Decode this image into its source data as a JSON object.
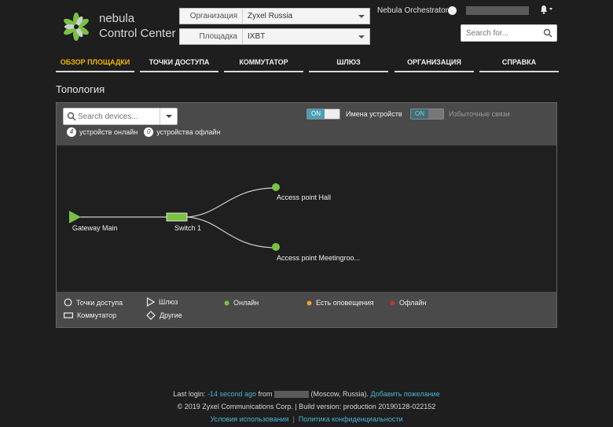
{
  "brand": {
    "line1": "nebula",
    "line2": "Control Center",
    "icon": "nebula-flower-logo"
  },
  "selectors": [
    {
      "label": "Организация",
      "value": "Zyxel Russia"
    },
    {
      "label": "Площадка",
      "value": "IXBT"
    }
  ],
  "header": {
    "orchestrator": "Nebula Orchestrator",
    "search_placeholder": "Search for...",
    "bell_icon": "bell-icon"
  },
  "nav": [
    {
      "label": "ОБЗОР ПЛОЩАДКИ",
      "active": true
    },
    {
      "label": "ТОЧКИ ДОСТУПА"
    },
    {
      "label": "КОММУТАТОР"
    },
    {
      "label": "ШЛЮЗ"
    },
    {
      "label": "ОРГАНИЗАЦИЯ"
    },
    {
      "label": "СПРАВКА"
    }
  ],
  "page_title": "Топология",
  "toolbar": {
    "device_search_placeholder": "Search devices...",
    "online_count": "4",
    "online_label": "устройств онлайн",
    "offline_count": "0",
    "offline_label": "устройства офлайн",
    "toggle_names": {
      "state": "ON",
      "label": "Имена устройств"
    },
    "toggle_redundant": {
      "state": "ON",
      "label": "Избыточные связи"
    }
  },
  "topology": {
    "nodes": [
      {
        "name": "Gateway Main",
        "type": "gateway"
      },
      {
        "name": "Switch 1",
        "type": "switch"
      },
      {
        "name": "Access point Hall",
        "type": "ap"
      },
      {
        "name": "Access point Meetingroo...",
        "type": "ap"
      }
    ]
  },
  "legend": {
    "ap": "Точки доступа",
    "gateway": "Шлюз",
    "switch": "Коммутатор",
    "other": "Другие",
    "online": "Онлайн",
    "alerts": "Есть оповещения",
    "offline": "Офлайн",
    "colors": {
      "online": "#7ac143",
      "alerts": "#f0a030",
      "offline": "#c0392b"
    }
  },
  "footer": {
    "last_login_prefix": "Last login: ",
    "last_login_time": "-14 second ago",
    "from": " from ",
    "location": " (Moscow, Russia).",
    "feedback": "Добавить пожелание",
    "copyright": "© 2019 Zyxel Communications Corp.  |  Build version: production 20190128-022152",
    "terms": "Условия использования",
    "privacy": "Политика конфиденциальности"
  }
}
